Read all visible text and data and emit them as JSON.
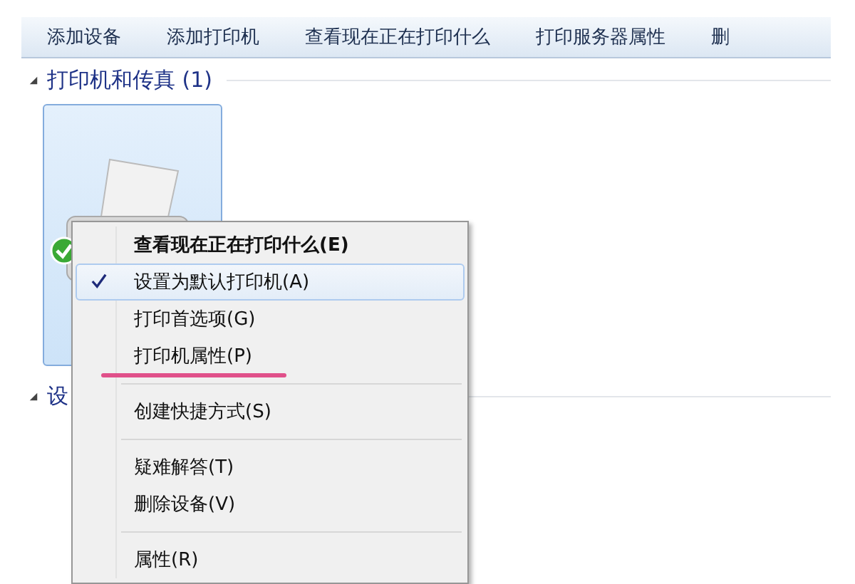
{
  "toolbar": {
    "items": [
      "添加设备",
      "添加打印机",
      "查看现在正在打印什么",
      "打印服务器属性",
      "删"
    ]
  },
  "sections": [
    {
      "title": "打印机和传真 (1)",
      "expanded": true,
      "devices": [
        {
          "kind": "printer",
          "selected": true,
          "default": true
        }
      ]
    },
    {
      "title": "设",
      "expanded": true
    }
  ],
  "context_menu": {
    "items": [
      {
        "kind": "item",
        "label": "查看现在正在打印什么(E)",
        "bold": true,
        "checked": false,
        "selected": false,
        "underlined": false
      },
      {
        "kind": "item",
        "label": "设置为默认打印机(A)",
        "bold": false,
        "checked": true,
        "selected": true,
        "underlined": false
      },
      {
        "kind": "item",
        "label": "打印首选项(G)",
        "bold": false,
        "checked": false,
        "selected": false,
        "underlined": false
      },
      {
        "kind": "item",
        "label": "打印机属性(P)",
        "bold": false,
        "checked": false,
        "selected": false,
        "underlined": true
      },
      {
        "kind": "separator"
      },
      {
        "kind": "item",
        "label": "创建快捷方式(S)",
        "bold": false,
        "checked": false,
        "selected": false,
        "underlined": false
      },
      {
        "kind": "separator"
      },
      {
        "kind": "item",
        "label": "疑难解答(T)",
        "bold": false,
        "checked": false,
        "selected": false,
        "underlined": false
      },
      {
        "kind": "item",
        "label": "删除设备(V)",
        "bold": false,
        "checked": false,
        "selected": false,
        "underlined": false
      },
      {
        "kind": "separator"
      },
      {
        "kind": "item",
        "label": "属性(R)",
        "bold": false,
        "checked": false,
        "selected": false,
        "underlined": false
      }
    ]
  }
}
